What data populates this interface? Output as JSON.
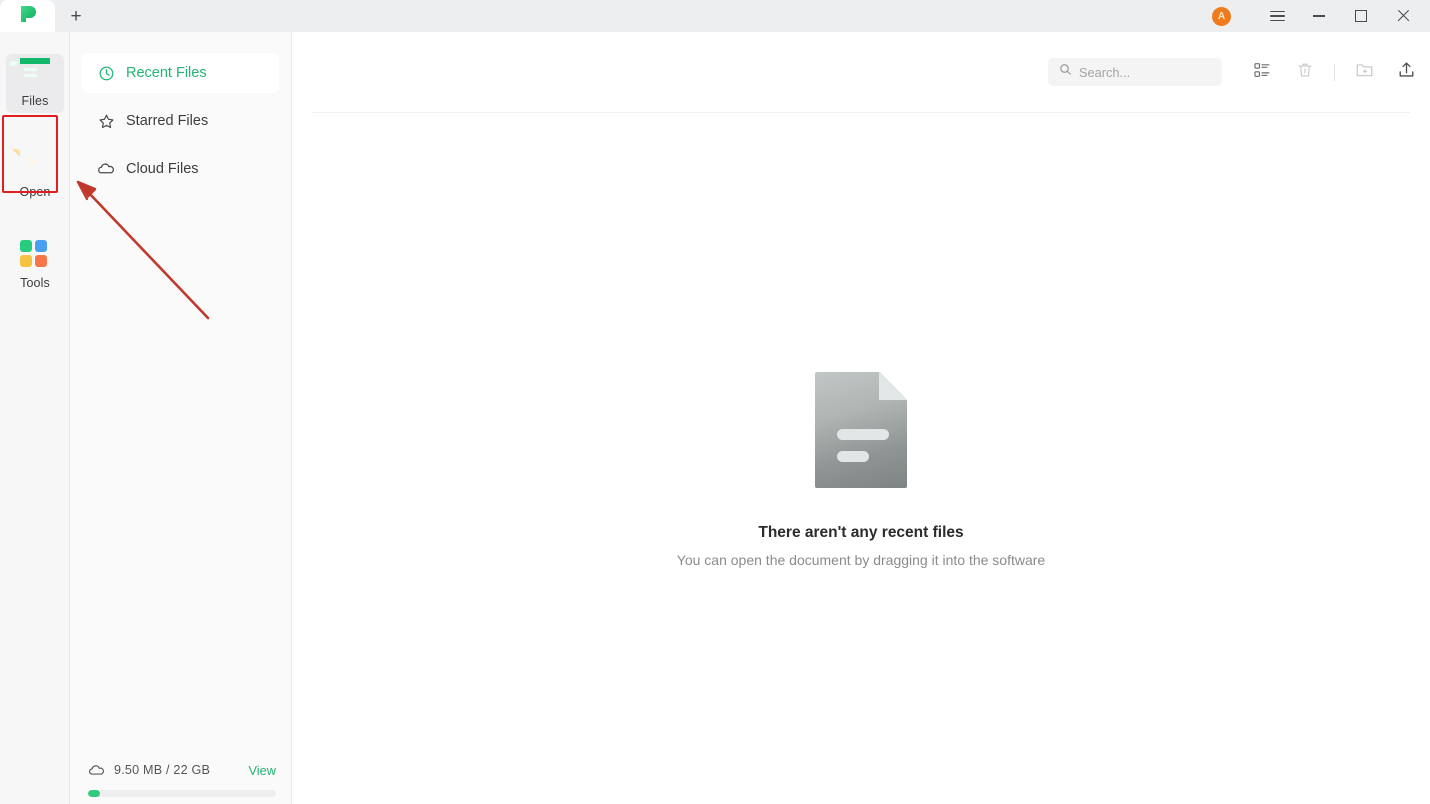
{
  "window": {
    "app_logo_icon": "updf-logo-icon",
    "new_tab_label": "+",
    "avatar_initial": "A",
    "menu_icon": "hamburger-icon",
    "minimize_icon": "minimize-icon",
    "maximize_icon": "maximize-icon",
    "close_icon": "close-icon"
  },
  "rail": {
    "items": [
      {
        "label": "Files",
        "icon": "files-icon",
        "selected": true
      },
      {
        "label": "Open",
        "icon": "open-file-icon",
        "selected": false
      },
      {
        "label": "Tools",
        "icon": "tools-grid-icon",
        "selected": false
      }
    ]
  },
  "nav": {
    "items": [
      {
        "label": "Recent Files",
        "icon": "clock-icon",
        "selected": true
      },
      {
        "label": "Starred Files",
        "icon": "star-icon",
        "selected": false
      },
      {
        "label": "Cloud Files",
        "icon": "cloud-icon",
        "selected": false
      }
    ]
  },
  "storage": {
    "icon": "cloud-icon",
    "usage_text": "9.50 MB / 22 GB",
    "view_label": "View",
    "used_percent": 0.04,
    "fill_color": "#34c97f"
  },
  "toolbar": {
    "search_placeholder": "Search...",
    "search_icon": "search-icon",
    "list_view_icon": "list-view-icon",
    "trash_icon": "trash-icon",
    "new_folder_icon": "new-folder-icon",
    "upload_icon": "upload-icon"
  },
  "empty_state": {
    "illustration": "document-icon",
    "title": "There aren't any recent files",
    "subtitle": "You can open the document by dragging it into the software"
  },
  "annotations": {
    "highlight_color": "#e02020",
    "arrow_color": "#c0392b",
    "highlight_target": "Open",
    "arrow_points_to": "nav-panel-left-edge"
  },
  "colors": {
    "accent_green": "#22b573",
    "titlebar": "#eceef0",
    "sidebar": "#f7f7f8",
    "navpanel": "#fafafa"
  }
}
